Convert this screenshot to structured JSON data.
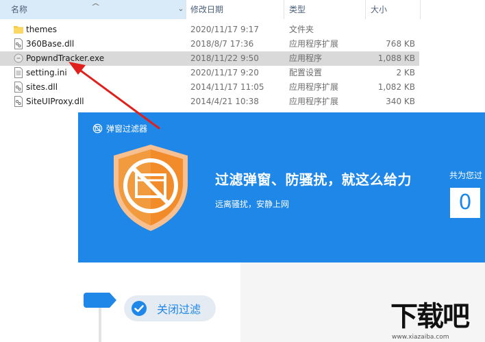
{
  "explorer": {
    "columns": {
      "name": "名称",
      "date": "修改日期",
      "type": "类型",
      "size": "大小"
    },
    "files": [
      {
        "name": "themes",
        "date": "2020/11/17 9:17",
        "type": "文件夹",
        "size": "",
        "icon": "folder-icon",
        "selected": false
      },
      {
        "name": "360Base.dll",
        "date": "2018/8/7 17:36",
        "type": "应用程序扩展",
        "size": "768 KB",
        "icon": "dll-file-icon",
        "selected": false
      },
      {
        "name": "PopwndTracker.exe",
        "date": "2018/11/22 9:50",
        "type": "应用程序",
        "size": "1,088 KB",
        "icon": "exe-file-icon",
        "selected": true
      },
      {
        "name": "setting.ini",
        "date": "2020/11/17 9:20",
        "type": "配置设置",
        "size": "2 KB",
        "icon": "ini-file-icon",
        "selected": false
      },
      {
        "name": "sites.dll",
        "date": "2014/11/17 11:05",
        "type": "应用程序扩展",
        "size": "1,082 KB",
        "icon": "dll-file-icon",
        "selected": false
      },
      {
        "name": "SiteUIProxy.dll",
        "date": "2014/4/21 10:38",
        "type": "应用程序扩展",
        "size": "340 KB",
        "icon": "dll-file-icon",
        "selected": false
      }
    ]
  },
  "app": {
    "title": "弹窗过滤器",
    "headline": "过滤弹窗、防骚扰，就这么给力",
    "subline": "远离骚扰，安静上网",
    "stat_label": "共为您过",
    "counter_digit": "0",
    "toggle_label": "关闭过滤",
    "colors": {
      "brand_blue": "#1e87e8",
      "shield_orange": "#f19a3e"
    }
  },
  "watermark": {
    "text": "下载吧",
    "url": "www.xiazaiba.com"
  },
  "annotation": {
    "arrow_color": "#e0201d"
  }
}
